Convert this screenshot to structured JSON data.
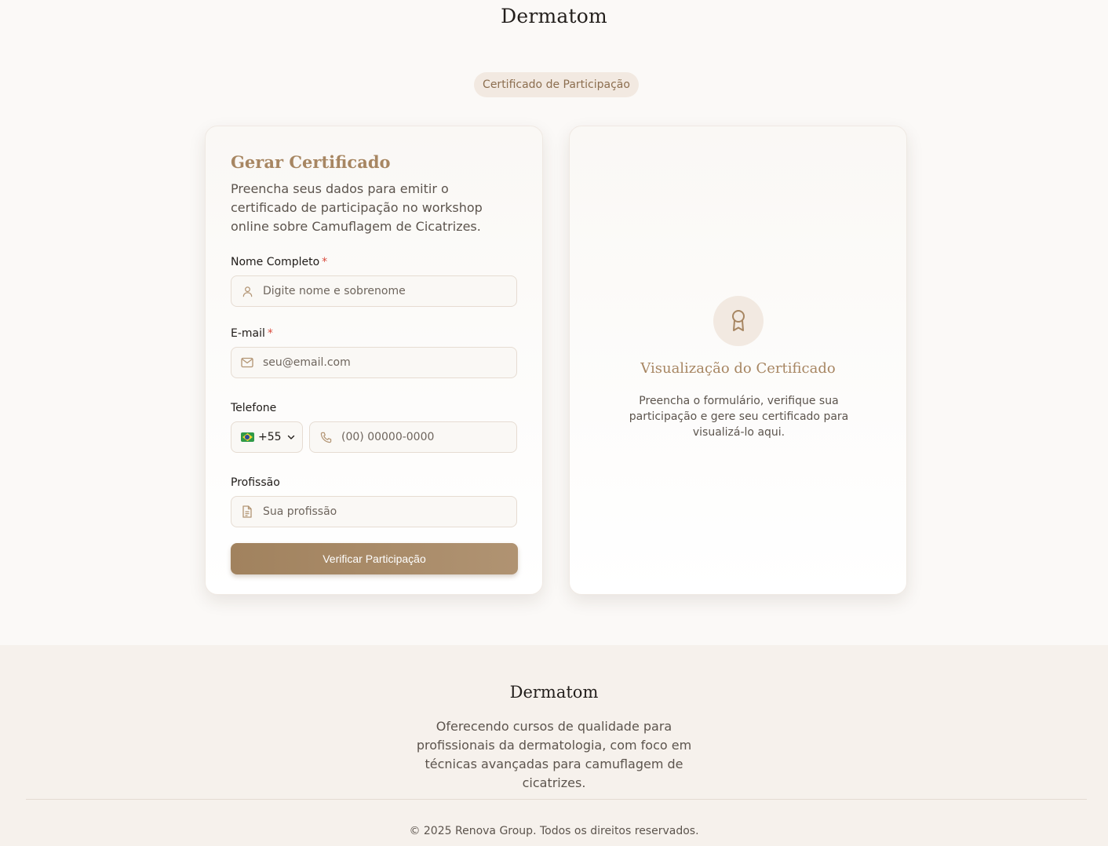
{
  "header": {
    "brand": "Dermatom"
  },
  "badge": {
    "label": "Certificado de Participação"
  },
  "form": {
    "title": "Gerar Certificado",
    "description": "Preencha seus dados para emitir o certificado de participação no workshop online sobre Camuflagem de Cicatrizes.",
    "fields": {
      "name": {
        "label": "Nome Completo",
        "required_mark": "*",
        "placeholder": "Digite nome e sobrenome",
        "icon": "user-icon"
      },
      "email": {
        "label": "E-mail",
        "required_mark": "*",
        "placeholder": "seu@email.com",
        "icon": "mail-icon"
      },
      "phone": {
        "label": "Telefone",
        "country_code": "+55",
        "country_flag": "brazil-flag-icon",
        "placeholder": "(00) 00000-0000",
        "icon": "phone-icon"
      },
      "profession": {
        "label": "Profissão",
        "placeholder": "Sua profissão",
        "icon": "document-icon"
      }
    },
    "submit_label": "Verificar Participação"
  },
  "preview": {
    "icon": "award-icon",
    "title": "Visualização do Certificado",
    "description": "Preencha o formulário, verifique sua participação e gere seu certificado para visualizá-lo aqui."
  },
  "footer": {
    "brand": "Dermatom",
    "description": "Oferecendo cursos de qualidade para profissionais da dermatologia, com foco em técnicas avançadas para camuflagem de cicatrizes.",
    "copyright": "© 2025 Renova Group. Todos os direitos reservados."
  },
  "colors": {
    "accent": "#a78662",
    "button": "#a1825e",
    "badge_bg": "#f2e9e1",
    "required": "#d94a3d",
    "page_bg": "#fbf9f7"
  }
}
